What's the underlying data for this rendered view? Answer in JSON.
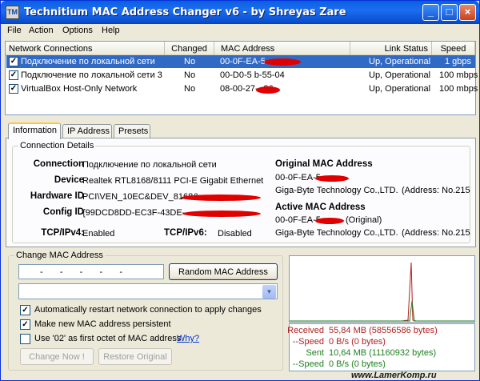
{
  "window": {
    "title": "Technitium MAC Address Changer v6 - by Shreyas Zare",
    "icon_text": "TM"
  },
  "menu": [
    "File",
    "Action",
    "Options",
    "Help"
  ],
  "network_list": {
    "columns": [
      "Network Connections",
      "Changed",
      "MAC Address",
      "Link Status",
      "Speed"
    ],
    "rows": [
      {
        "name": "Подключение по локальной сети",
        "changed": "No",
        "mac": "00-0F-EA-5",
        "status": "Up, Operational",
        "speed": "1 gbps",
        "checked": true,
        "selected": true
      },
      {
        "name": "Подключение по локальной сети 3",
        "changed": "No",
        "mac": "00-D0-5   b-55-04",
        "status": "Up, Operational",
        "speed": "100 mbps",
        "checked": true,
        "selected": false
      },
      {
        "name": "VirtualBox Host-Only Network",
        "changed": "No",
        "mac": "08-00-27-       -26",
        "status": "Up, Operational",
        "speed": "100 mbps",
        "checked": true,
        "selected": false
      }
    ]
  },
  "tabs": [
    "Information",
    "IP Address",
    "Presets"
  ],
  "connection_details": {
    "group_title": "Connection Details",
    "connection_label": "Connection",
    "connection_value": "Подключение по локальной сети",
    "device_label": "Device",
    "device_value": "Realtek RTL8168/8111 PCI-E Gigabit Ethernet",
    "hardware_label": "Hardware ID",
    "hardware_value": "PCI\\VEN_10EC&DEV_8168&",
    "config_label": "Config ID",
    "config_value": "{99DCD8DD-EC3F-43DE-",
    "tcpv4_label": "TCP/IPv4:",
    "tcpv4_value": "Enabled",
    "tcpv6_label": "TCP/IPv6:",
    "tcpv6_value": "Disabled",
    "original_mac_title": "Original MAC Address",
    "original_mac_value": "00-0F-EA-5",
    "original_vendor": "Giga-Byte Technology Co.,LTD.",
    "original_address": "(Address: No.215",
    "active_mac_title": "Active MAC Address",
    "active_mac_value": "00-0F-EA-5",
    "active_mac_suffix": "(Original)",
    "active_vendor": "Giga-Byte Technology Co.,LTD.",
    "active_address": "(Address: No.215"
  },
  "change_mac": {
    "group_title": "Change MAC Address",
    "mac_input_value": "-   -   -   -   -",
    "random_button": "Random MAC Address",
    "options": [
      {
        "label": "Automatically restart network connection to apply changes",
        "checked": true
      },
      {
        "label": "Make new MAC address persistent",
        "checked": true
      },
      {
        "label": "Use '02' as first octet of MAC address",
        "checked": false,
        "link": "Why?"
      }
    ],
    "change_now_button": "Change Now !",
    "restore_button": "Restore Original"
  },
  "traffic": {
    "received_label": "Received",
    "received_value": "55,84 MB (58556586 bytes)",
    "received_speed_label": "--Speed",
    "received_speed_value": "0 B/s (0 bytes)",
    "sent_label": "Sent",
    "sent_value": "10,64 MB (11160932 bytes)",
    "sent_speed_label": "--Speed",
    "sent_speed_value": "0 B/s (0 bytes)",
    "received_color": "#b02020",
    "sent_color": "#208020"
  },
  "watermark": "www.LamerKomp.ru"
}
